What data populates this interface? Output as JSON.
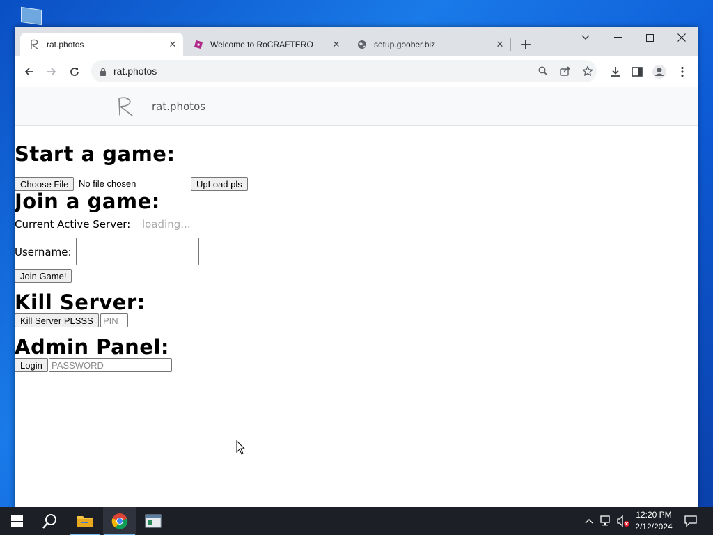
{
  "browser": {
    "tabs": [
      {
        "title": "rat.photos",
        "favicon": "rat-logo-icon",
        "active": true
      },
      {
        "title": "Welcome to RoCRAFTERO",
        "favicon": "roblox-icon",
        "active": false
      },
      {
        "title": "setup.goober.biz",
        "favicon": "globe-icon",
        "active": false
      }
    ],
    "url": "rat.photos"
  },
  "site": {
    "name": "rat.photos"
  },
  "page": {
    "start_heading": "Start a game:",
    "choose_file_label": "Choose File",
    "file_status": "No file chosen",
    "upload_label": "UpLoad pls",
    "join_heading": "Join a game:",
    "active_server_label": "Current Active Server:",
    "active_server_value": "loading...",
    "username_label": "Username:",
    "username_value": "",
    "join_button": "Join Game!",
    "kill_heading": "Kill Server:",
    "kill_button": "Kill Server PLSSS",
    "pin_placeholder": "PIN",
    "admin_heading": "Admin Panel:",
    "login_button": "Login",
    "password_placeholder": "PASSWORD"
  },
  "taskbar": {
    "time": "12:20 PM",
    "date": "2/12/2024"
  },
  "colors": {
    "tabstrip": "#dee1e6",
    "desktop": "#0d5bd6",
    "taskbar": "#1c1f26",
    "roblox": "#b02a8a"
  }
}
